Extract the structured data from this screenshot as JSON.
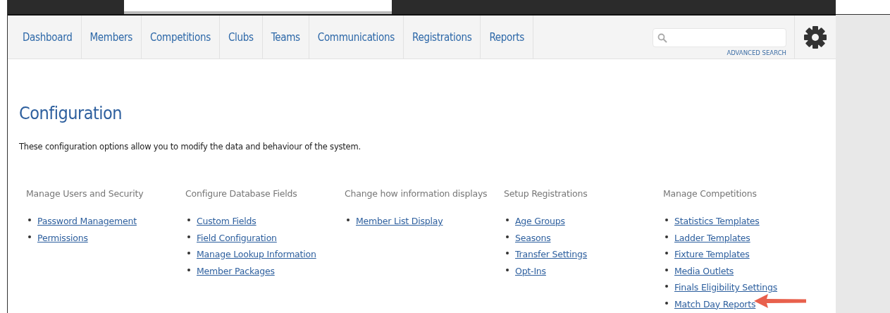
{
  "nav": {
    "tabs": [
      {
        "label": "Dashboard",
        "selected": false
      },
      {
        "label": "Members",
        "selected": false
      },
      {
        "label": "Competitions",
        "selected": false
      },
      {
        "label": "Clubs",
        "selected": false
      },
      {
        "label": "Teams",
        "selected": false
      },
      {
        "label": "Communications",
        "selected": false
      },
      {
        "label": "Registrations",
        "selected": false
      },
      {
        "label": "Reports",
        "selected": false
      }
    ],
    "advanced_search": "ADVANCED SEARCH"
  },
  "page": {
    "title": "Configuration",
    "description": "These configuration options allow you to modify the data and behaviour of the system.",
    "sections": [
      {
        "heading": "Manage Users and Security",
        "links": [
          "Password Management",
          "Permissions"
        ]
      },
      {
        "heading": "Configure Database Fields",
        "links": [
          "Custom Fields",
          "Field Configuration",
          "Manage Lookup Information",
          "Member Packages"
        ]
      },
      {
        "heading": "Change how information displays",
        "links": [
          "Member List Display"
        ]
      },
      {
        "heading": "Setup Registrations",
        "links": [
          "Age Groups",
          "Seasons",
          "Transfer Settings",
          "Opt-Ins"
        ]
      },
      {
        "heading": "Manage Competitions",
        "links": [
          "Statistics Templates",
          "Ladder Templates",
          "Fixture Templates",
          "Media Outlets",
          "Finals Eligibility Settings",
          "Match Day Reports"
        ]
      }
    ]
  }
}
